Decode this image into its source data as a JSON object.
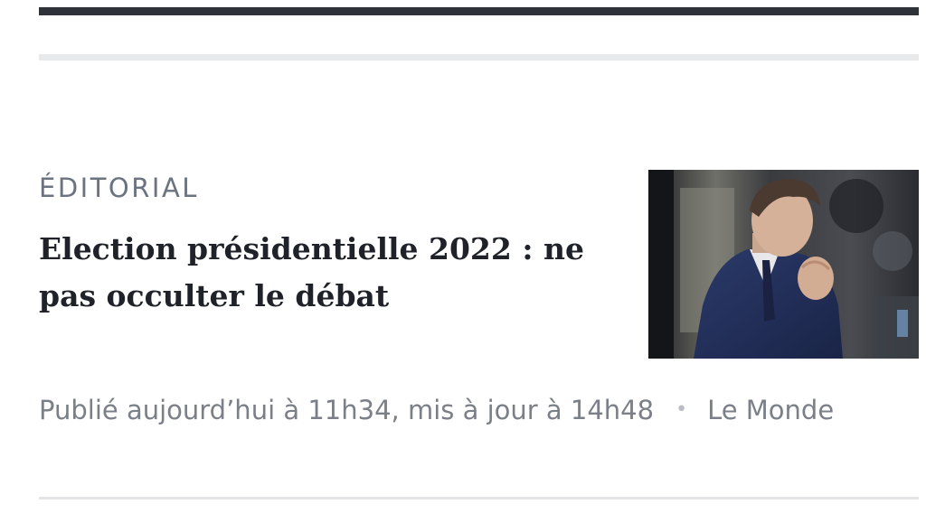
{
  "article": {
    "kicker": "ÉDITORIAL",
    "headline": "Election présidentielle 2022 : ne pas occulter le débat",
    "published": "Publié aujourd’hui à 11h34, mis à jour à 14h48",
    "separator": "•",
    "source": "Le Monde",
    "thumbnail_icon": "news-photo-icon"
  },
  "colors": {
    "top_bar": "#2f3238",
    "kicker": "#6b7280",
    "headline": "#1f2228",
    "meta": "#7b7f87",
    "divider": "#e8e9eb"
  }
}
